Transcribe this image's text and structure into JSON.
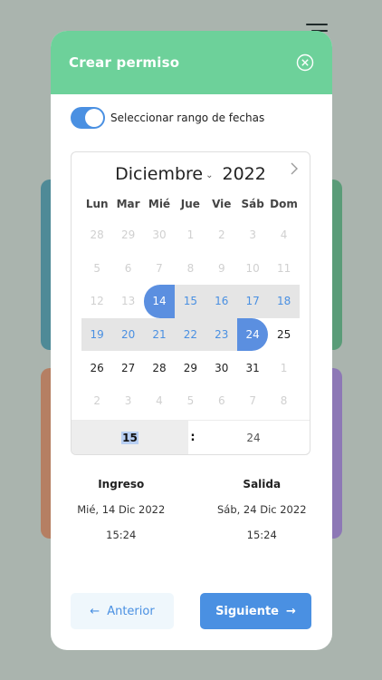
{
  "modal": {
    "title": "Crear permiso",
    "toggle_label": "Seleccionar rango de fechas",
    "toggle_on": true
  },
  "calendar": {
    "month": "Diciembre",
    "year": "2022",
    "weekdays": [
      "Lun",
      "Mar",
      "Mié",
      "Jue",
      "Vie",
      "Sáb",
      "Dom"
    ],
    "weeks": [
      [
        "28",
        "29",
        "30",
        "1",
        "2",
        "3",
        "4"
      ],
      [
        "5",
        "6",
        "7",
        "8",
        "9",
        "10",
        "11"
      ],
      [
        "12",
        "13",
        "14",
        "15",
        "16",
        "17",
        "18"
      ],
      [
        "19",
        "20",
        "21",
        "22",
        "23",
        "24",
        "25"
      ],
      [
        "26",
        "27",
        "28",
        "29",
        "30",
        "31",
        "1"
      ],
      [
        "2",
        "3",
        "4",
        "5",
        "6",
        "7",
        "8"
      ]
    ],
    "states": [
      [
        "m",
        "m",
        "m",
        "m",
        "m",
        "m",
        "m"
      ],
      [
        "m",
        "m",
        "m",
        "m",
        "m",
        "m",
        "m"
      ],
      [
        "m",
        "m",
        "s",
        "r",
        "r",
        "r",
        "r"
      ],
      [
        "r",
        "r",
        "r",
        "r",
        "r",
        "e",
        "n"
      ],
      [
        "n",
        "n",
        "n",
        "n",
        "n",
        "n",
        "m"
      ],
      [
        "m",
        "m",
        "m",
        "m",
        "m",
        "m",
        "m"
      ]
    ],
    "time": {
      "hour": "15",
      "separator": ":",
      "minute": "24"
    }
  },
  "summary": {
    "ingreso": {
      "label": "Ingreso",
      "date": "Mié, 14 Dic 2022",
      "time": "15:24"
    },
    "salida": {
      "label": "Salida",
      "date": "Sáb, 24 Dic 2022",
      "time": "15:24"
    }
  },
  "buttons": {
    "prev": {
      "label": "Anterior",
      "arrow": "←"
    },
    "next": {
      "label": "Siguiente",
      "arrow": "→"
    }
  },
  "colors": {
    "header": "#6dd19a",
    "accent": "#4a90e2",
    "range_band": "#e5e5e5",
    "range_edge": "#5b8fe0"
  }
}
